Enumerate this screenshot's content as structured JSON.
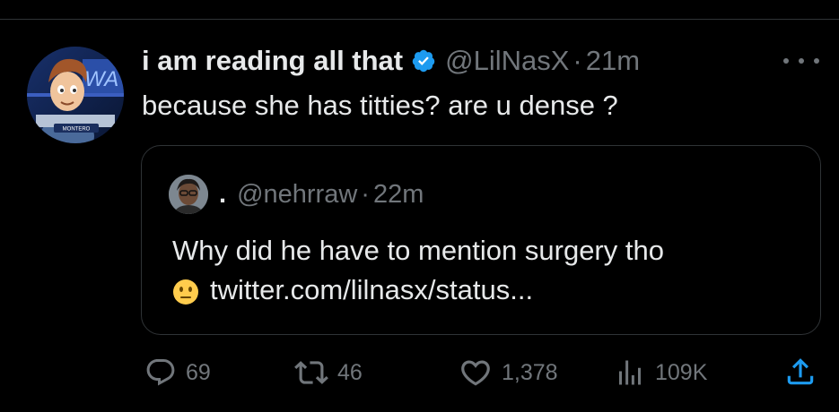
{
  "tweet": {
    "display_name": "i am reading all that",
    "handle": "@LilNasX",
    "separator": "·",
    "time": "21m",
    "text": "because she has titties? are u dense ?",
    "avatar_caption": "MONTERO",
    "avatar_sign": "WA"
  },
  "quote": {
    "display_name": ".",
    "handle": "@nehrraw",
    "separator": "·",
    "time": "22m",
    "text_line1": "Why did he have to mention surgery tho",
    "emoji": "neutral-face-emoji",
    "link": "twitter.com/lilnasx/status..."
  },
  "actions": {
    "replies": "69",
    "retweets": "46",
    "likes": "1,378",
    "views": "109K"
  },
  "colors": {
    "background": "#000000",
    "text": "#e7e9ea",
    "secondary": "#71767b",
    "verified": "#1d9bf0",
    "border": "#2f3336"
  }
}
